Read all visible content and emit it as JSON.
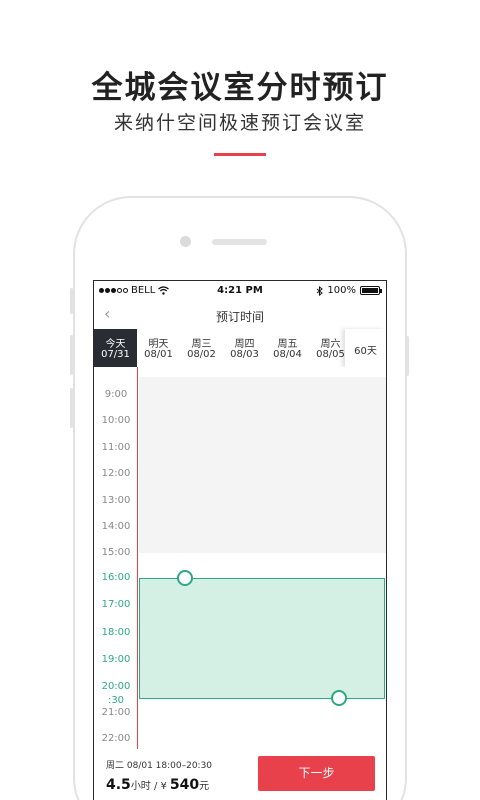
{
  "promo": {
    "title": "全城会议室分时预订",
    "subtitle": "来纳什空间极速预订会议室"
  },
  "status_bar": {
    "carrier": "BELL",
    "time": "4:21 PM",
    "battery": "100%"
  },
  "nav": {
    "title": "预订时间"
  },
  "dates": [
    {
      "day": "今天",
      "date": "07/31",
      "active": true
    },
    {
      "day": "明天",
      "date": "08/01",
      "active": false
    },
    {
      "day": "周三",
      "date": "08/02",
      "active": false
    },
    {
      "day": "周四",
      "date": "08/03",
      "active": false
    },
    {
      "day": "周五",
      "date": "08/04",
      "active": false
    },
    {
      "day": "周六",
      "date": "08/05",
      "active": false
    }
  ],
  "more_days_label": "60天",
  "times": [
    "9:00",
    "10:00",
    "11:00",
    "12:00",
    "13:00",
    "14:00",
    "15:00",
    "16:00",
    "17:00",
    "18:00",
    "19:00",
    "20:00",
    ":30",
    "21:00",
    "22:00"
  ],
  "selection": {
    "start": "18:00",
    "end": "20:30"
  },
  "footer": {
    "summary": "周二 08/01  18:00–20:30",
    "hours": "4.5",
    "hours_unit": "小时",
    "separator": " / ",
    "currency": "¥",
    "price": "540",
    "price_unit": "元",
    "next_label": "下一步"
  },
  "colors": {
    "accent_red": "#e8414b",
    "selection_green": "#2ea883",
    "selection_fill": "#d4efe3",
    "active_tab": "#2a2c33"
  }
}
